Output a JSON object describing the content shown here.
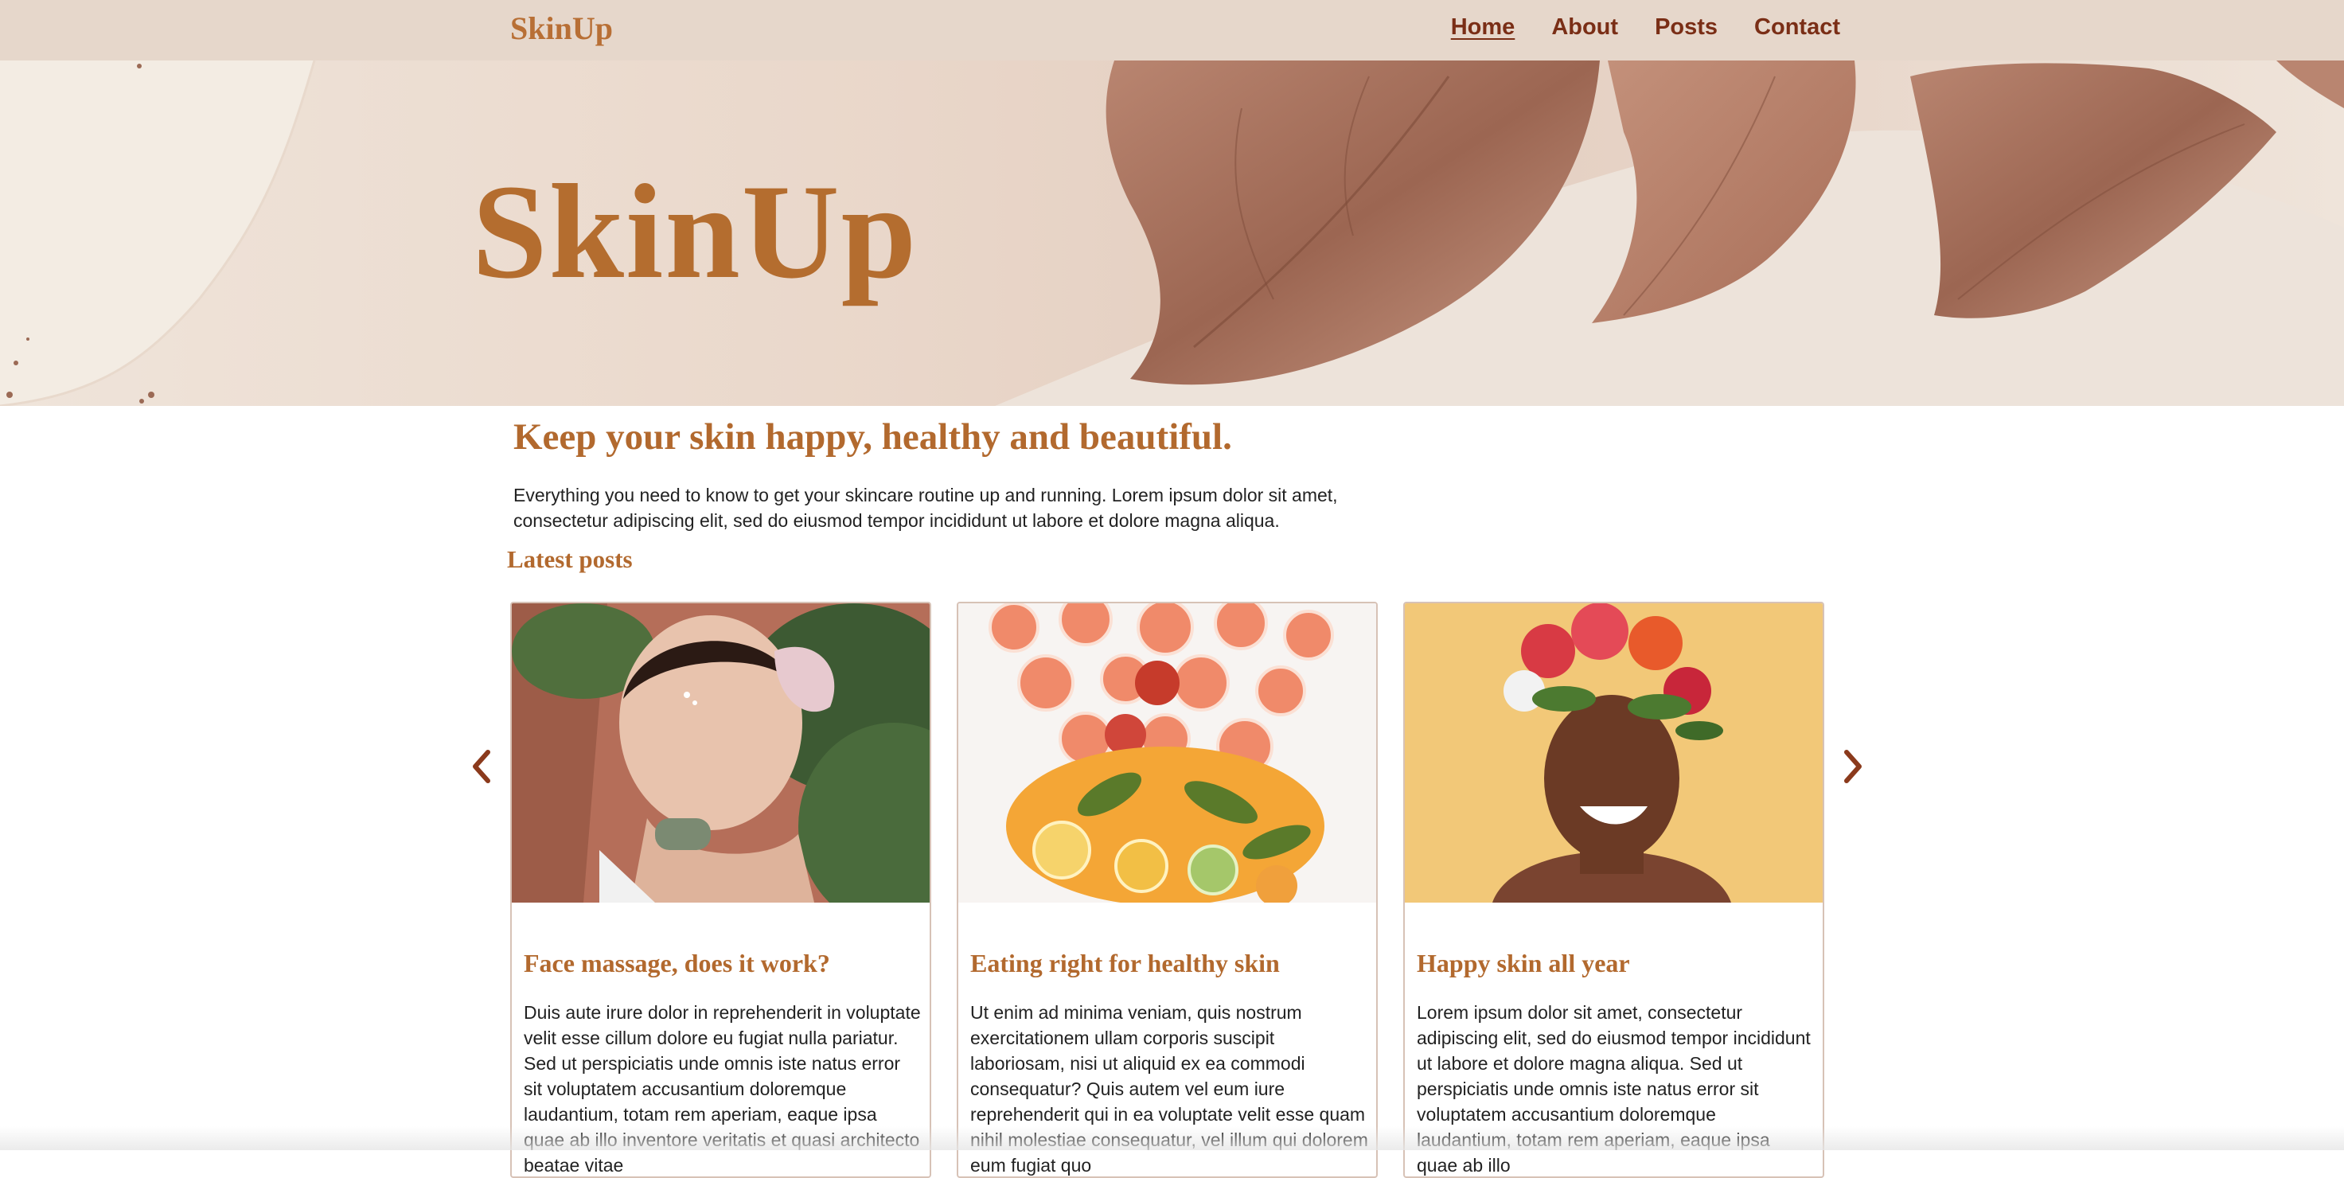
{
  "nav": {
    "logo": "SkinUp",
    "links": [
      "Home",
      "About",
      "Posts",
      "Contact"
    ],
    "active": "Home"
  },
  "hero": {
    "title": "SkinUp"
  },
  "intro": {
    "tagline": "Keep your skin happy, healthy and beautiful.",
    "text": "Everything you need to know to get your skincare routine up and running. Lorem ipsum dolor sit amet, consectetur adipiscing elit, sed do eiusmod tempor incididunt ut labore et dolore magna aliqua."
  },
  "posts": {
    "heading": "Latest posts",
    "items": [
      {
        "title": "Face massage, does it work?",
        "excerpt": "Duis aute irure dolor in reprehenderit in voluptate velit esse cillum dolore eu fugiat nulla pariatur. Sed ut perspiciatis unde omnis iste natus error sit voluptatem accusantium doloremque laudantium, totam rem aperiam, eaque ipsa quae ab illo inventore veritatis et quasi architecto beatae vitae"
      },
      {
        "title": "Eating right for healthy skin",
        "excerpt": "Ut enim ad minima veniam, quis nostrum exercitationem ullam corporis suscipit laboriosam, nisi ut aliquid ex ea commodi consequatur? Quis autem vel eum iure reprehenderit qui in ea voluptate velit esse quam nihil molestiae consequatur, vel illum qui dolorem eum fugiat quo"
      },
      {
        "title": "Happy skin all year",
        "excerpt": "Lorem ipsum dolor sit amet, consectetur adipiscing elit, sed do eiusmod tempor incididunt ut labore et dolore magna aliqua. Sed ut perspiciatis unde omnis iste natus error sit voluptatem accusantium doloremque laudantium, totam rem aperiam, eaque ipsa quae ab illo"
      }
    ]
  },
  "icons": {
    "prev": "chevron-left-icon",
    "next": "chevron-right-icon"
  },
  "colors": {
    "accent": "#b2692e",
    "nav_bg": "#e6d7cb",
    "nav_link": "#7a2e16",
    "card_border": "#d7c2b6"
  }
}
